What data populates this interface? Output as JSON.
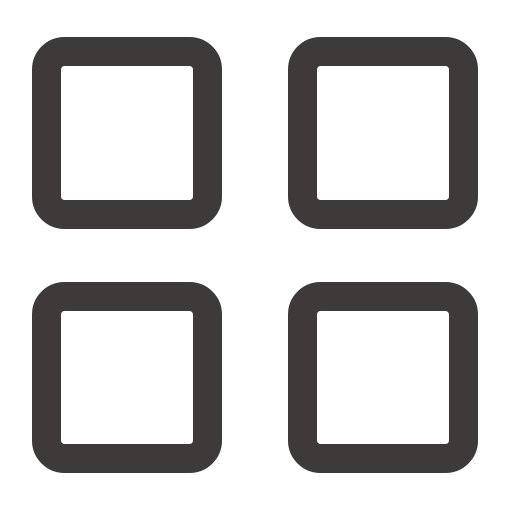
{
  "icon": {
    "name": "grid-icon",
    "stroke_color": "#3d3a39",
    "background_color": "#ffffff",
    "tiles": [
      {
        "name": "grid-tile-top-left"
      },
      {
        "name": "grid-tile-top-right"
      },
      {
        "name": "grid-tile-bottom-left"
      },
      {
        "name": "grid-tile-bottom-right"
      }
    ]
  }
}
